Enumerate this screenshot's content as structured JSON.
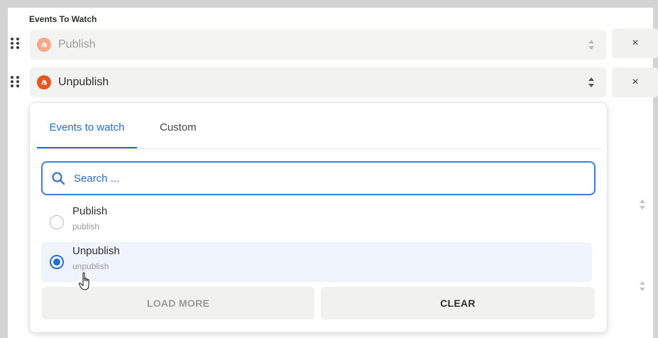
{
  "section": {
    "label": "Events To Watch"
  },
  "rows": [
    {
      "label": "Publish",
      "state": "disabled",
      "icon": "webhook-app-icon",
      "remove_symbol": "×"
    },
    {
      "label": "Unpublish",
      "state": "active",
      "icon": "webhook-app-icon",
      "remove_symbol": "×"
    }
  ],
  "dropdown": {
    "tabs": [
      {
        "label": "Events to watch",
        "active": true
      },
      {
        "label": "Custom",
        "active": false
      }
    ],
    "search": {
      "placeholder": "Search ..."
    },
    "options": [
      {
        "title": "Publish",
        "subtitle": "publish",
        "selected": false
      },
      {
        "title": "Unpublish",
        "subtitle": "unpublish",
        "selected": true
      }
    ],
    "buttons": {
      "load_more": "LOAD MORE",
      "clear": "CLEAR"
    }
  },
  "colors": {
    "accent": "#1f6dd4",
    "app_icon": "#e8561f",
    "selected_row": "#eff4fc"
  }
}
